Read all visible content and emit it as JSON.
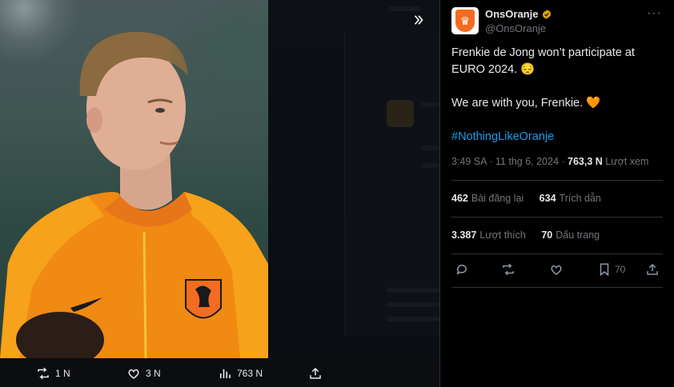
{
  "viewer": {
    "expand_icon": "chevrons-right-icon",
    "actions": [
      {
        "icon": "retweet-icon",
        "count": "1 N"
      },
      {
        "icon": "heart-icon",
        "count": "3 N"
      },
      {
        "icon": "views-icon",
        "count": "763 N"
      },
      {
        "icon": "share-icon",
        "count": ""
      }
    ]
  },
  "tweet": {
    "display_name": "OnsOranje",
    "handle": "@OnsOranje",
    "verified_color": "#e2a409",
    "line1": "Frenkie de Jong won’t participate at EURO 2024. 😔",
    "line2": "We are with you, Frenkie. 🧡",
    "hashtag": "#NothingLikeOranje",
    "time": "3:49 SA · 11 thg 6, 2024 ·",
    "views_count": "763,3 N",
    "views_label": "Lượt xem",
    "reposts_count": "462",
    "reposts_label": "Bài đăng lại",
    "quotes_count": "634",
    "quotes_label": "Trích dẫn",
    "likes_count": "3.387",
    "likes_label": "Lượt thích",
    "bookmarks_count": "70",
    "bookmarks_label": "Dấu trang",
    "bookmark_action_count": "70"
  },
  "colors": {
    "accent": "#1d9bf0",
    "brand_orange": "#f36c21"
  }
}
